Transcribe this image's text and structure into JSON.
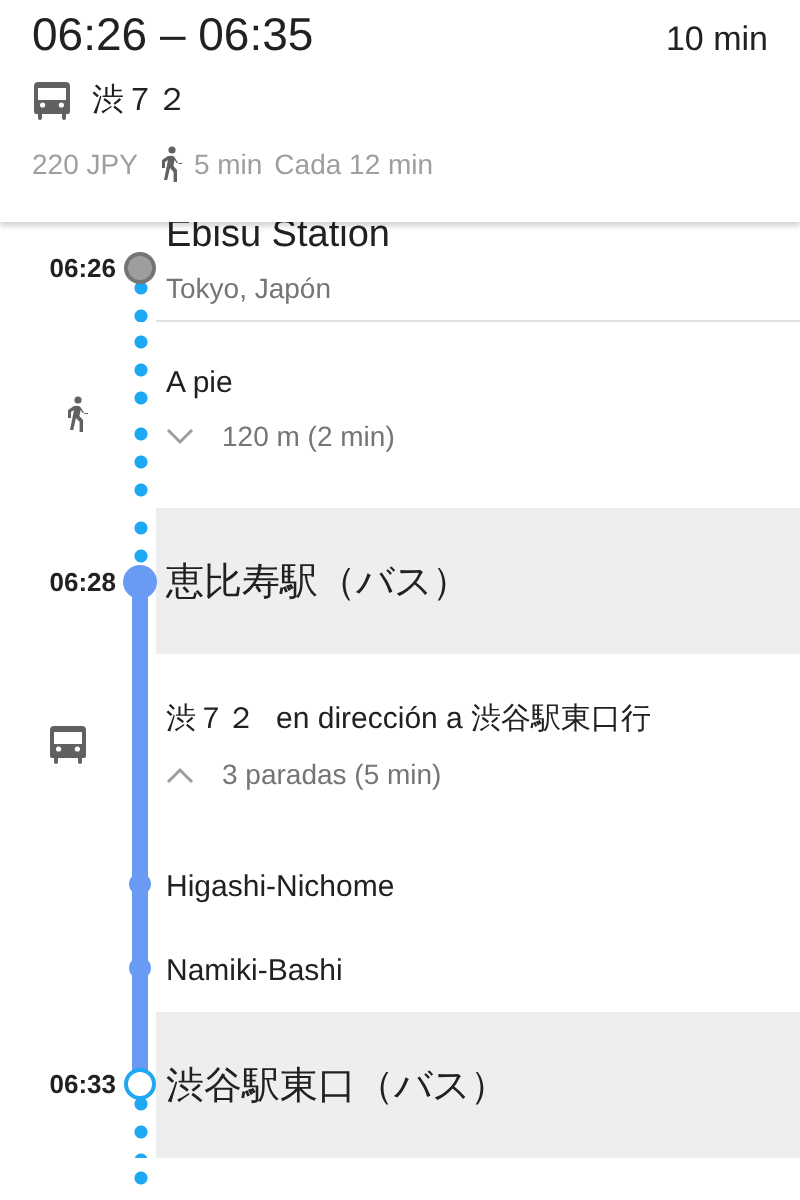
{
  "header": {
    "time_range": "06:26 – 06:35",
    "duration": "10 min",
    "route": "渋７２",
    "fare": "220 JPY",
    "walk_time": "5 min",
    "frequency": "Cada 12 min"
  },
  "steps": [
    {
      "kind": "origin",
      "time": "06:26",
      "title": "Ebisu Station",
      "subtitle": "Tokyo, Japón"
    },
    {
      "kind": "walk",
      "title": "A pie",
      "detail": "120 m (2 min)",
      "expanded": false
    },
    {
      "kind": "stop",
      "time": "06:28",
      "title": "恵比寿駅（バス）"
    },
    {
      "kind": "transit",
      "route": "渋７２",
      "direction": "en dirección a 渋谷駅東口行",
      "detail": "3 paradas (5 min)",
      "expanded": true
    },
    {
      "kind": "intermediate",
      "title": "Higashi-Nichome"
    },
    {
      "kind": "intermediate",
      "title": "Namiki-Bashi"
    },
    {
      "kind": "destination",
      "time": "06:33",
      "title": "渋谷駅東口（バス）"
    }
  ]
}
